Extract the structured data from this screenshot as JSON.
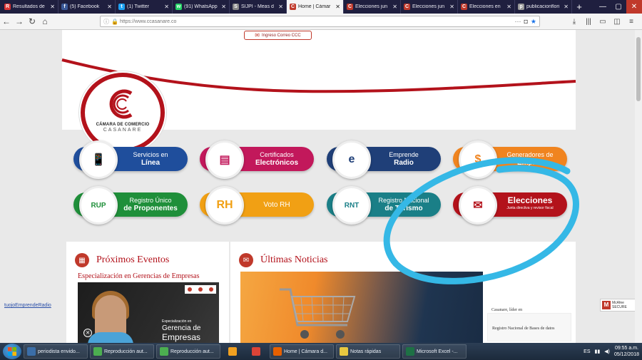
{
  "browser": {
    "tabs": [
      {
        "title": "Resultados de",
        "fav_color": "#d33",
        "fav": "R",
        "active": false
      },
      {
        "title": "(5) Facebook",
        "fav_color": "#3b5998",
        "fav": "f",
        "active": false
      },
      {
        "title": "(1) Twitter",
        "fav_color": "#1da1f2",
        "fav": "t",
        "active": false
      },
      {
        "title": "(91) WhatsApp",
        "fav_color": "#25d366",
        "fav": "w",
        "active": false
      },
      {
        "title": "SIJPI - Meas d",
        "fav_color": "#888",
        "fav": "S",
        "active": false
      },
      {
        "title": "Home | Cámar",
        "fav_color": "#c0392b",
        "fav": "C",
        "active": true
      },
      {
        "title": "Elecciones jun",
        "fav_color": "#c0392b",
        "fav": "C",
        "active": false
      },
      {
        "title": "Elecciones jun",
        "fav_color": "#c0392b",
        "fav": "C",
        "active": false
      },
      {
        "title": "Elecciones en",
        "fav_color": "#c0392b",
        "fav": "C",
        "active": false
      },
      {
        "title": "publicacionflori",
        "fav_color": "#999",
        "fav": "p",
        "active": false
      }
    ],
    "new_tab": "+",
    "url": "https://www.ccasanare.co",
    "min": "—",
    "max": "▢",
    "close": "✕"
  },
  "header": {
    "mail_button": "Ingreso Correo CCC",
    "logo_line1": "CÁMARA DE COMERCIO",
    "logo_line2": "CASANARE"
  },
  "services": [
    {
      "line1": "Servicios en",
      "line2": "Línea",
      "color": "#1f4e9c",
      "icon": "phone-icon",
      "glyph": "📱"
    },
    {
      "line1": "Certificados",
      "line2": "Electrónicos",
      "color": "#c2185b",
      "icon": "certificate-icon",
      "glyph": "▤"
    },
    {
      "line1": "Emprende",
      "line2": "Radio",
      "color": "#1f3f78",
      "icon": "radio-icon",
      "glyph": "e"
    },
    {
      "line1": "Generadores de",
      "line2": "Empleo",
      "color": "#f0841f",
      "icon": "money-icon",
      "glyph": "$"
    },
    {
      "line1": "Registro Único",
      "line2": "de Proponentes",
      "color": "#1f8f3a",
      "icon": "rup-icon",
      "glyph": "RUP"
    },
    {
      "single": "Voto RH",
      "color": "#f1a014",
      "icon": "rh-icon",
      "glyph": "RH"
    },
    {
      "line1": "Registro Nacional",
      "line2": "de Turismo",
      "color": "#1a7f87",
      "icon": "rnt-icon",
      "glyph": "RNT"
    },
    {
      "line1": "Elecciones",
      "line2": "Junta directiva y revisor fiscal",
      "color": "#b3121b",
      "icon": "ballot-icon",
      "glyph": "✉"
    }
  ],
  "events": {
    "title": "Próximos Eventos",
    "link": "Especialización en Gerencias de Empresas",
    "img_small": "Especialización en",
    "img_big1": "Gerencia de",
    "img_big2": "Empresas"
  },
  "news": {
    "title": "Últimas Noticias",
    "side_text": "Registro Nacional de Bases de datos",
    "side_text2": "Casanare, líder en"
  },
  "footer_link": "tuojoEmprendeRadio",
  "mcafee": {
    "line1": "McAfee",
    "line2": "SECURE"
  },
  "taskbar": {
    "items": [
      {
        "label": "periodista envido...",
        "color": "#3b6ea8",
        "wide": true
      },
      {
        "label": "Reproducción aut...",
        "color": "#4caf50",
        "wide": true
      },
      {
        "label": "Reproducción aut...",
        "color": "#4caf50",
        "wide": true
      },
      {
        "label": "",
        "color": "#f0a020",
        "wide": false
      },
      {
        "label": "",
        "color": "#db4437",
        "wide": false
      },
      {
        "label": "Home | Cámara d...",
        "color": "#e66000",
        "wide": true
      },
      {
        "label": "Notas rápidas",
        "color": "#e8c840",
        "wide": true
      },
      {
        "label": "Microsoft Excel -...",
        "color": "#1e7145",
        "wide": true
      }
    ],
    "lang": "ES",
    "time": "09:55 a.m.",
    "date": "05/12/2018"
  }
}
